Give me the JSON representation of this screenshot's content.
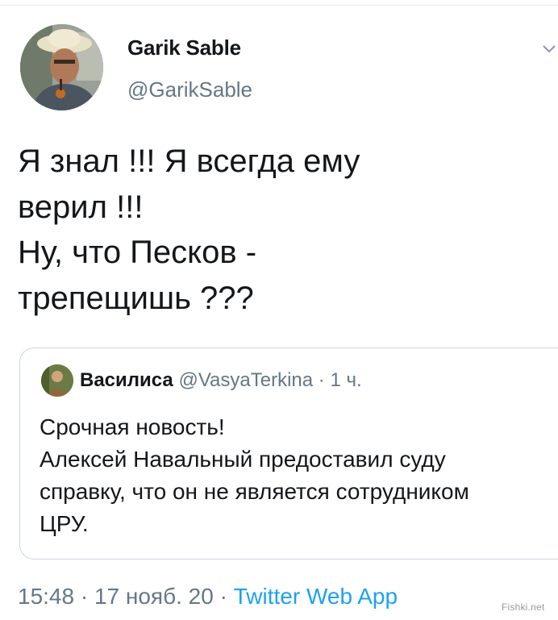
{
  "author": {
    "name": "Garik Sable",
    "handle": "@GarikSable"
  },
  "icons": {
    "menu": "chevron-down-icon"
  },
  "tweet": {
    "lines": [
      "Я знал !!! Я всегда ему",
      "верил !!!",
      "Ну, что Песков -",
      "трепещишь ???"
    ]
  },
  "quoted": {
    "name": "Василиса",
    "handle": "@VasyaTerkina",
    "time": "· 1 ч.",
    "lines": [
      "Срочная новость!",
      "Алексей Навальный предоставил суду",
      "справку, что он не является сотрудником",
      "ЦРУ."
    ]
  },
  "meta": {
    "time": "15:48",
    "date": "· 17 нояб. 20 ·",
    "source": "Twitter Web App"
  },
  "watermark": "Fishki.net",
  "colors": {
    "text": "#14171a",
    "secondary": "#657786",
    "link": "#1da1f2",
    "border": "#ccd6dd"
  }
}
